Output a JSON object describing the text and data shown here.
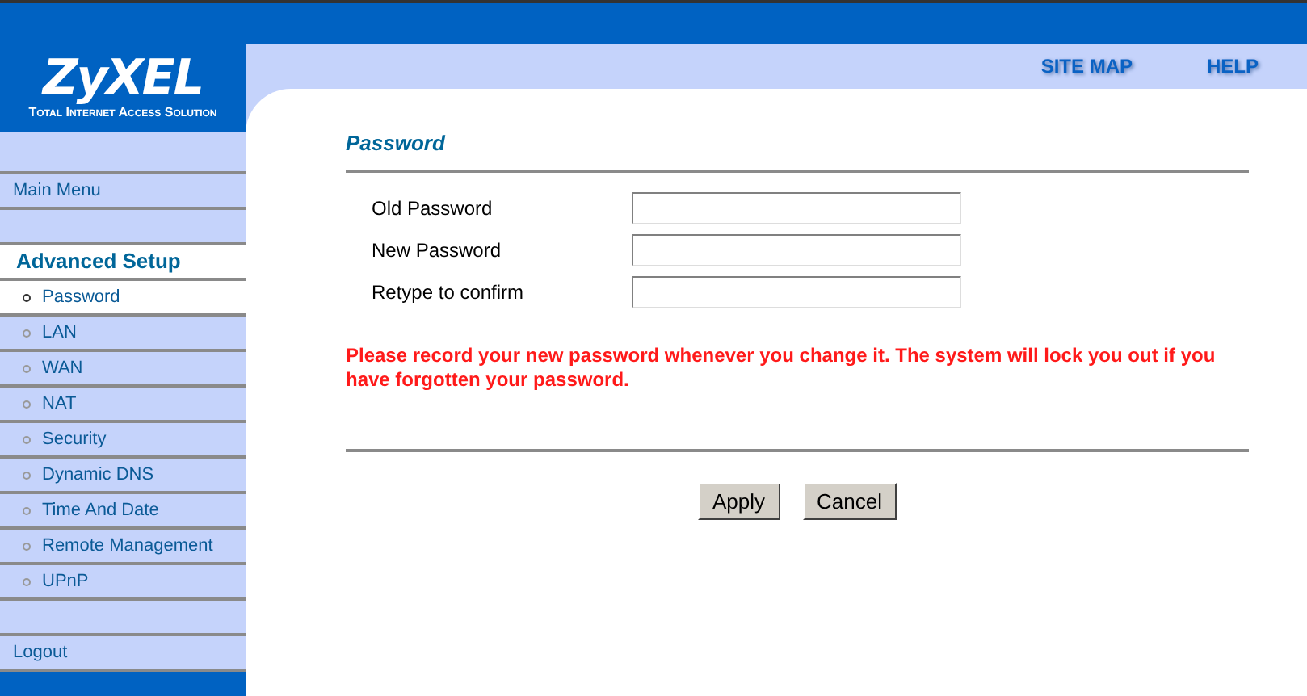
{
  "logo": {
    "brand": "ZyXEL",
    "tagline": "Total Internet Access Solution"
  },
  "top_links": [
    "SITE MAP",
    "HELP"
  ],
  "sidebar": {
    "items": [
      {
        "kind": "spacer"
      },
      {
        "kind": "link",
        "label": "Main Menu",
        "selected": false
      },
      {
        "kind": "spacer"
      },
      {
        "kind": "heading",
        "label": "Advanced Setup"
      },
      {
        "kind": "sub",
        "label": "Password",
        "selected": true
      },
      {
        "kind": "sub",
        "label": "LAN",
        "selected": false
      },
      {
        "kind": "sub",
        "label": "WAN",
        "selected": false
      },
      {
        "kind": "sub",
        "label": "NAT",
        "selected": false
      },
      {
        "kind": "sub",
        "label": "Security",
        "selected": false
      },
      {
        "kind": "sub",
        "label": "Dynamic DNS",
        "selected": false
      },
      {
        "kind": "sub",
        "label": "Time And Date",
        "selected": false
      },
      {
        "kind": "sub",
        "label": "Remote Management",
        "selected": false
      },
      {
        "kind": "sub",
        "label": "UPnP",
        "selected": false
      },
      {
        "kind": "spacer"
      },
      {
        "kind": "link",
        "label": "Logout",
        "selected": false
      }
    ]
  },
  "page_title": "Password",
  "fields": [
    {
      "label": "Old Password"
    },
    {
      "label": "New Password"
    },
    {
      "label": "Retype to confirm"
    }
  ],
  "warning": "Please record your new password whenever you change it. The system will lock you out if you have forgotten your password.",
  "buttons": [
    "Apply",
    "Cancel"
  ]
}
